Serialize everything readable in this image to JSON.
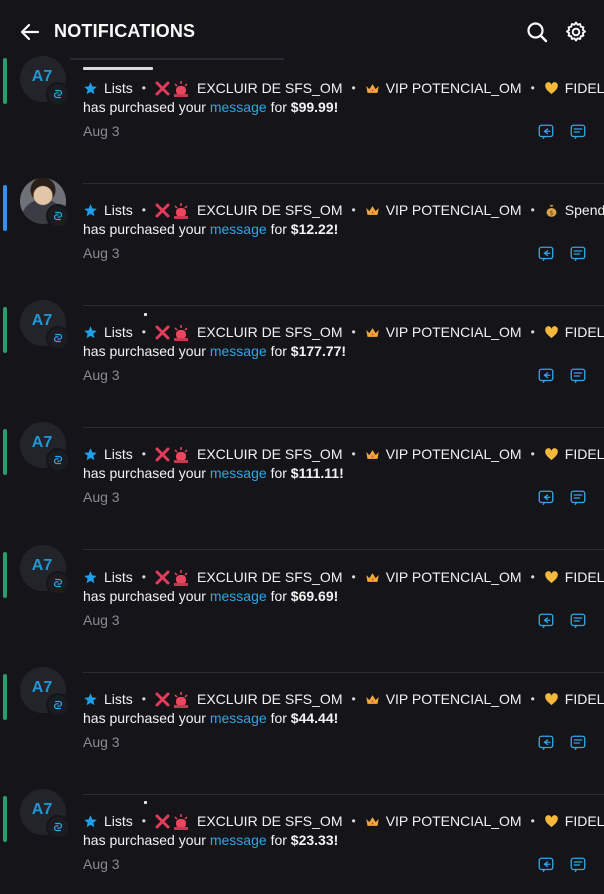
{
  "header": {
    "title": "NOTIFICATIONS",
    "back_icon": "arrow-left-icon",
    "search_icon": "search-icon",
    "settings_icon": "gear-icon"
  },
  "colors": {
    "background": "#151519",
    "accent_link": "#2ea6e8",
    "bar_green": "#2f9a6e",
    "bar_blue": "#3a8ee6",
    "date_gray": "#8a8b91"
  },
  "notifications": [
    {
      "avatar_text": "A7",
      "avatar_type": "initials",
      "bar_color": "green",
      "lists": [
        "Lists",
        "EXCLUIR DE SFS_OM",
        "VIP POTENCIAL_OM",
        "FIDELIZA"
      ],
      "emojis": [
        "star",
        "x-siren",
        "crown",
        "heart"
      ],
      "prefix": "has purchased your",
      "link_text": "message",
      "middle": "for",
      "amount": "$99.99!",
      "date": "Aug 3"
    },
    {
      "avatar_text": "",
      "avatar_type": "photo",
      "bar_color": "blue",
      "lists": [
        "Lists",
        "EXCLUIR DE SFS_OM",
        "VIP POTENCIAL_OM",
        "Spenders"
      ],
      "emojis": [
        "star",
        "x-siren",
        "crown",
        "money-bag"
      ],
      "prefix": "has purchased your",
      "link_text": "message",
      "middle": "for",
      "amount": "$12.22!",
      "date": "Aug 3"
    },
    {
      "avatar_text": "A7",
      "avatar_type": "initials",
      "bar_color": "green",
      "lists": [
        "Lists",
        "EXCLUIR DE SFS_OM",
        "VIP POTENCIAL_OM",
        "FIDELIZA"
      ],
      "emojis": [
        "star",
        "x-siren",
        "crown",
        "heart"
      ],
      "prefix": "has purchased your",
      "link_text": "message",
      "middle": "for",
      "amount": "$177.77!",
      "date": "Aug 3"
    },
    {
      "avatar_text": "A7",
      "avatar_type": "initials",
      "bar_color": "green",
      "lists": [
        "Lists",
        "EXCLUIR DE SFS_OM",
        "VIP POTENCIAL_OM",
        "FIDELIZA"
      ],
      "emojis": [
        "star",
        "x-siren",
        "crown",
        "heart"
      ],
      "prefix": "has purchased your",
      "link_text": "message",
      "middle": "for",
      "amount": "$111.11!",
      "date": "Aug 3"
    },
    {
      "avatar_text": "A7",
      "avatar_type": "initials",
      "bar_color": "green",
      "lists": [
        "Lists",
        "EXCLUIR DE SFS_OM",
        "VIP POTENCIAL_OM",
        "FIDELIZA"
      ],
      "emojis": [
        "star",
        "x-siren",
        "crown",
        "heart"
      ],
      "prefix": "has purchased your",
      "link_text": "message",
      "middle": "for",
      "amount": "$69.69!",
      "date": "Aug 3"
    },
    {
      "avatar_text": "A7",
      "avatar_type": "initials",
      "bar_color": "green",
      "lists": [
        "Lists",
        "EXCLUIR DE SFS_OM",
        "VIP POTENCIAL_OM",
        "FIDELIZA"
      ],
      "emojis": [
        "star",
        "x-siren",
        "crown",
        "heart"
      ],
      "prefix": "has purchased your",
      "link_text": "message",
      "middle": "for",
      "amount": "$44.44!",
      "date": "Aug 3"
    },
    {
      "avatar_text": "A7",
      "avatar_type": "initials",
      "bar_color": "green",
      "lists": [
        "Lists",
        "EXCLUIR DE SFS_OM",
        "VIP POTENCIAL_OM",
        "FIDELIZA"
      ],
      "emojis": [
        "star",
        "x-siren",
        "crown",
        "heart"
      ],
      "prefix": "has purchased your",
      "link_text": "message",
      "middle": "for",
      "amount": "$23.33!",
      "date": "Aug 3"
    }
  ]
}
